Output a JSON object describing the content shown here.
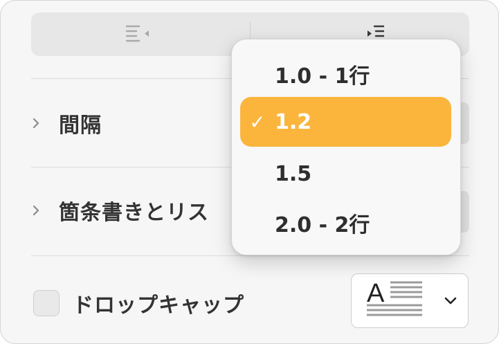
{
  "alignment": {
    "options": [
      "decrease-indent",
      "increase-indent"
    ]
  },
  "sections": [
    {
      "label": "間隔"
    },
    {
      "label": "箇条書きとリス"
    }
  ],
  "drop_cap": {
    "label": "ドロップキャップ",
    "preview_letter": "A",
    "checked": false
  },
  "line_spacing_menu": {
    "items": [
      {
        "label": "1.0 - 1行",
        "selected": false
      },
      {
        "label": "1.2",
        "selected": true
      },
      {
        "label": "1.5",
        "selected": false
      },
      {
        "label": "2.0 - 2行",
        "selected": false
      }
    ],
    "check_mark": "✓",
    "highlight_color": "#fbb53d"
  }
}
